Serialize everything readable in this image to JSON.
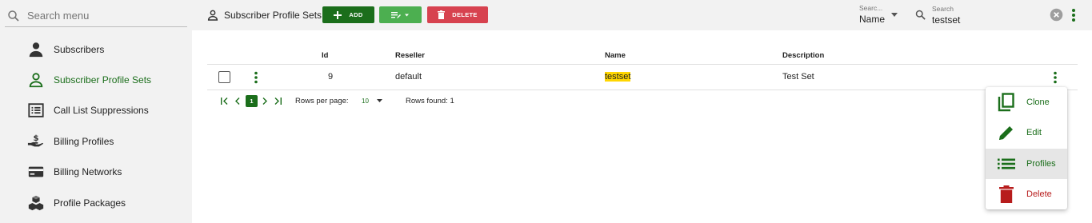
{
  "colors": {
    "primary": "#1b6e1b",
    "edit": "#4caf50",
    "danger": "#d7424f",
    "highlight": "#ffd600"
  },
  "sidebar": {
    "search_placeholder": "Search menu",
    "items": [
      {
        "label": "Subscribers",
        "icon": "person-icon"
      },
      {
        "label": "Subscriber Profile Sets",
        "icon": "person-outline-icon",
        "active": true
      },
      {
        "label": "Call List Suppressions",
        "icon": "list-box-icon"
      },
      {
        "label": "Billing Profiles",
        "icon": "hand-dollar-icon"
      },
      {
        "label": "Billing Networks",
        "icon": "credit-card-icon"
      },
      {
        "label": "Profile Packages",
        "icon": "boxes-icon"
      }
    ]
  },
  "toolbar": {
    "title": "Subscriber Profile Sets",
    "add_label": "ADD",
    "delete_label": "DELETE",
    "search_by_label": "Searc...",
    "search_by_value": "Name",
    "search_label": "Search",
    "search_value": "testset"
  },
  "table": {
    "columns": [
      "Id",
      "Reseller",
      "Name",
      "Description"
    ],
    "rows": [
      {
        "id": "9",
        "reseller": "default",
        "name": "testset",
        "description": "Test Set"
      }
    ]
  },
  "pagination": {
    "current_page": "1",
    "rows_per_page_label": "Rows per page:",
    "rows_per_page_value": "10",
    "rows_found": "Rows found: 1"
  },
  "row_menu": {
    "items": [
      {
        "label": "Clone",
        "icon": "copy-icon"
      },
      {
        "label": "Edit",
        "icon": "pencil-icon"
      },
      {
        "label": "Profiles",
        "icon": "list-icon",
        "hover": true
      },
      {
        "label": "Delete",
        "icon": "trash-icon"
      }
    ]
  }
}
